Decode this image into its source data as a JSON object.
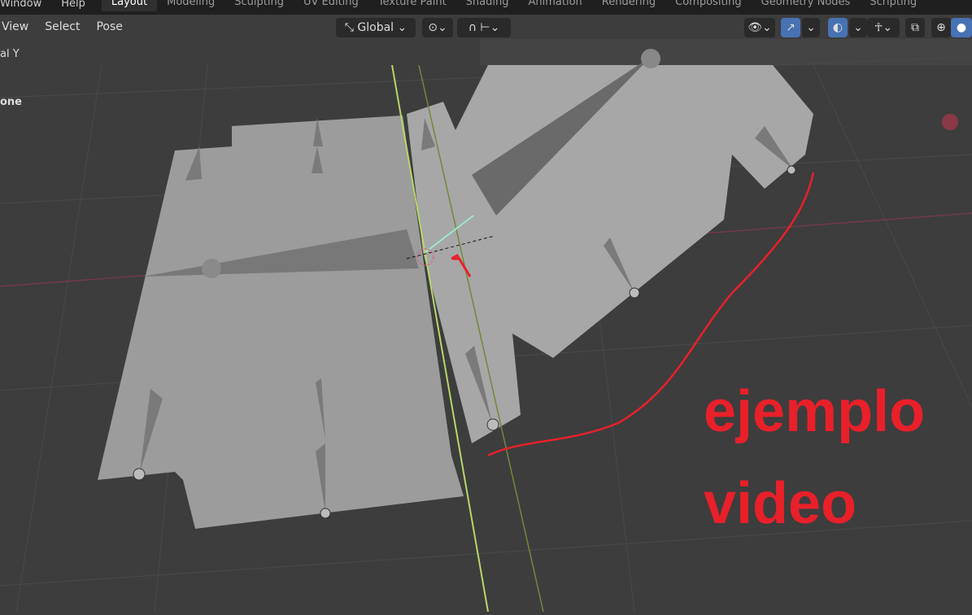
{
  "topbar": {
    "menus": [
      "Window",
      "Help"
    ],
    "workspaces": [
      "Layout",
      "Modeling",
      "Sculpting",
      "UV Editing",
      "Texture Paint",
      "Shading",
      "Animation",
      "Rendering",
      "Compositing",
      "Geometry Nodes",
      "Scripting"
    ],
    "active": "Layout"
  },
  "header": {
    "menus": [
      "View",
      "Select",
      "Pose"
    ],
    "orientation": "Global"
  },
  "overlay": {
    "line1": "al Y",
    "line2": "one"
  },
  "annotation": {
    "line1": "ejemplo",
    "line2": "video",
    "color": "#e8202a"
  }
}
